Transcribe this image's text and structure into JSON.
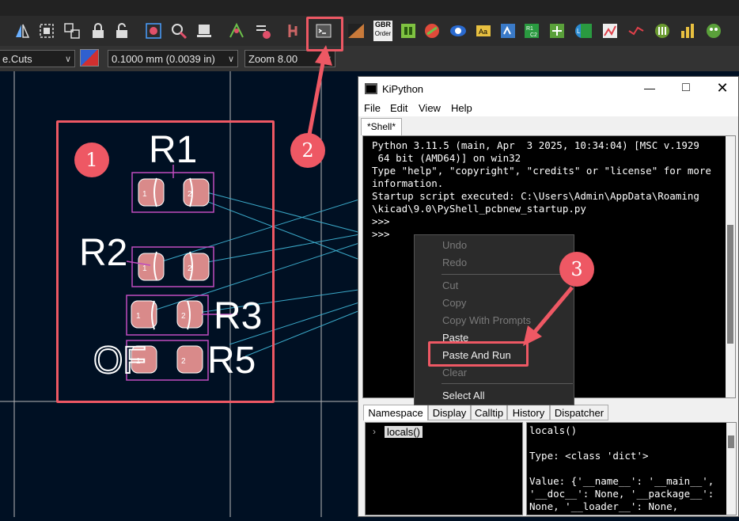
{
  "toolbar": {
    "layer_combo": "e.Cuts",
    "grid_combo": "0.1000 mm (0.0039 in)",
    "zoom_combo": "Zoom 8.00",
    "icons": [
      "mirror-icon",
      "select-box-icon",
      "group-icon",
      "lock-icon",
      "unlock-icon",
      "cleanup-icon",
      "inspect-icon",
      "board-setup-icon",
      "netlist-icon",
      "drc-icon",
      "footprint-editor-icon",
      "scripting-console-icon",
      "fabrication-icon",
      "gerber-order-icon",
      "bom-icon",
      "jlc-icon",
      "layout-icon",
      "3d-viewer-icon",
      "text-icon",
      "plugin-icon",
      "plugin2-icon",
      "lcsc-icon",
      "hierarchy-icon",
      "router-icon",
      "track-icon",
      "panelize-icon",
      "chart-icon",
      "pcb-calc-icon"
    ],
    "gbr_label": "GBR",
    "order_label": "Order"
  },
  "pcb": {
    "refs": [
      "R1",
      "R2",
      "R3",
      "R5"
    ],
    "footprint_pads": [
      "1",
      "2"
    ],
    "overlap_label": "OF"
  },
  "kipython": {
    "title": "KiPython",
    "menu": [
      "File",
      "Edit",
      "View",
      "Help"
    ],
    "shell_tab": "*Shell*",
    "shell_lines": [
      "Python 3.11.5 (main, Apr  3 2025, 10:34:04) [MSC v.1929",
      " 64 bit (AMD64)] on win32",
      "Type \"help\", \"copyright\", \"credits\" or \"license\" for more",
      "information.",
      "Startup script executed: C:\\Users\\Admin\\AppData\\Roaming",
      "\\kicad\\9.0\\PyShell_pcbnew_startup.py",
      ">>>",
      ">>>"
    ],
    "bottom_tabs": [
      "Namespace",
      "Display",
      "Calltip",
      "History",
      "Dispatcher"
    ],
    "namespace_item": "locals()",
    "detail_lines": [
      "locals()",
      "",
      "Type: <class 'dict'>",
      "",
      "Value: {'__name__': '__main__',",
      "'__doc__': None, '__package__':",
      "None, '__loader__': None,"
    ]
  },
  "context_menu": {
    "items": [
      {
        "label": "Undo",
        "enabled": false
      },
      {
        "label": "Redo",
        "enabled": false
      },
      {
        "label": "Cut",
        "enabled": false
      },
      {
        "label": "Copy",
        "enabled": false
      },
      {
        "label": "Copy With Prompts",
        "enabled": false
      },
      {
        "label": "Paste",
        "enabled": true
      },
      {
        "label": "Paste And Run",
        "enabled": true
      },
      {
        "label": "Clear",
        "enabled": false
      },
      {
        "label": "Select All",
        "enabled": true
      }
    ]
  },
  "annotations": [
    "1",
    "2",
    "3"
  ],
  "colors": {
    "annotation_red": "#ee5864",
    "canvas_bg": "#001023",
    "pad": "#d98a8a",
    "courtyard": "#c04cc0",
    "ratsnest": "#3aa8c8"
  }
}
